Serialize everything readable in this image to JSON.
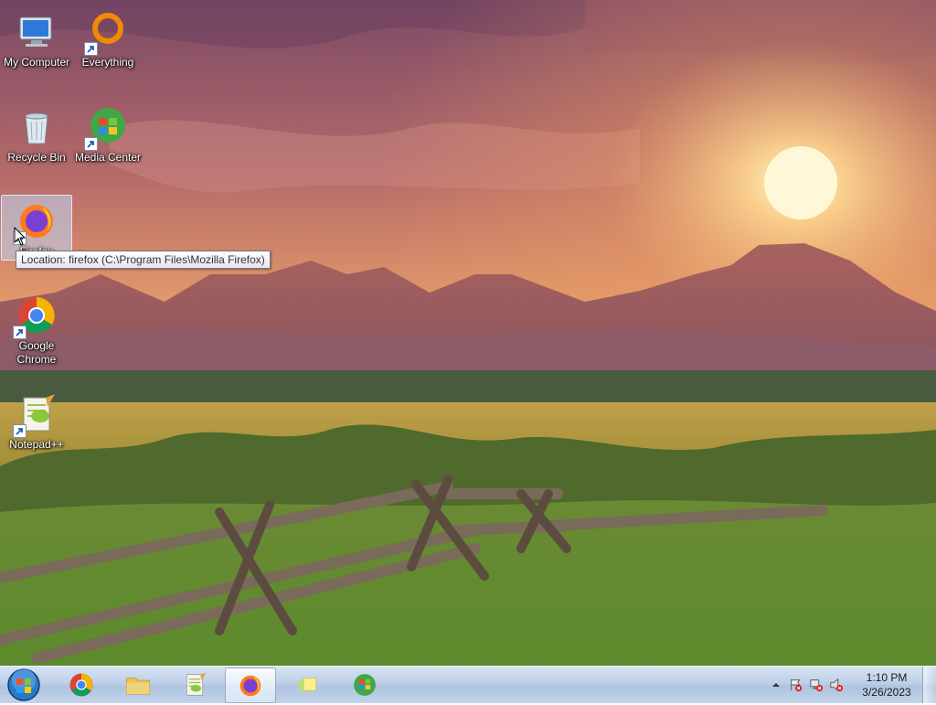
{
  "desktop": {
    "icons": [
      {
        "label": "My Computer",
        "icon": "computer-icon"
      },
      {
        "label": "Everything",
        "icon": "everything-icon"
      },
      {
        "label": "Recycle Bin",
        "icon": "recycle-bin-icon"
      },
      {
        "label": "Media Center",
        "icon": "media-center-icon"
      },
      {
        "label": "Firefox",
        "icon": "firefox-icon",
        "selected": true
      },
      {
        "label": "Google Chrome",
        "icon": "chrome-icon"
      },
      {
        "label": "Notepad++",
        "icon": "notepadpp-icon"
      }
    ],
    "tooltip": "Location: firefox (C:\\Program Files\\Mozilla Firefox)"
  },
  "taskbar": {
    "pinned": [
      {
        "name": "chrome",
        "icon": "chrome-icon"
      },
      {
        "name": "explorer",
        "icon": "folder-icon"
      },
      {
        "name": "notepadpp",
        "icon": "notepadpp-icon"
      },
      {
        "name": "firefox",
        "icon": "firefox-icon",
        "active": true
      },
      {
        "name": "sticky-notes",
        "icon": "sticky-notes-icon"
      },
      {
        "name": "media-center",
        "icon": "media-center-icon"
      }
    ],
    "tray": {
      "icons": [
        "show-hidden-icons-icon",
        "action-center-icon",
        "network-icon",
        "volume-muted-icon"
      ]
    },
    "clock": {
      "time": "1:10 PM",
      "date": "3/26/2023"
    }
  },
  "colors": {
    "sky_top": "#7d4a68",
    "sun": "#fff4c0",
    "mountains": "#9a5a5a",
    "field": "#b9a140",
    "grass": "#6f9a3a",
    "taskbar": "#c2d3ea"
  }
}
